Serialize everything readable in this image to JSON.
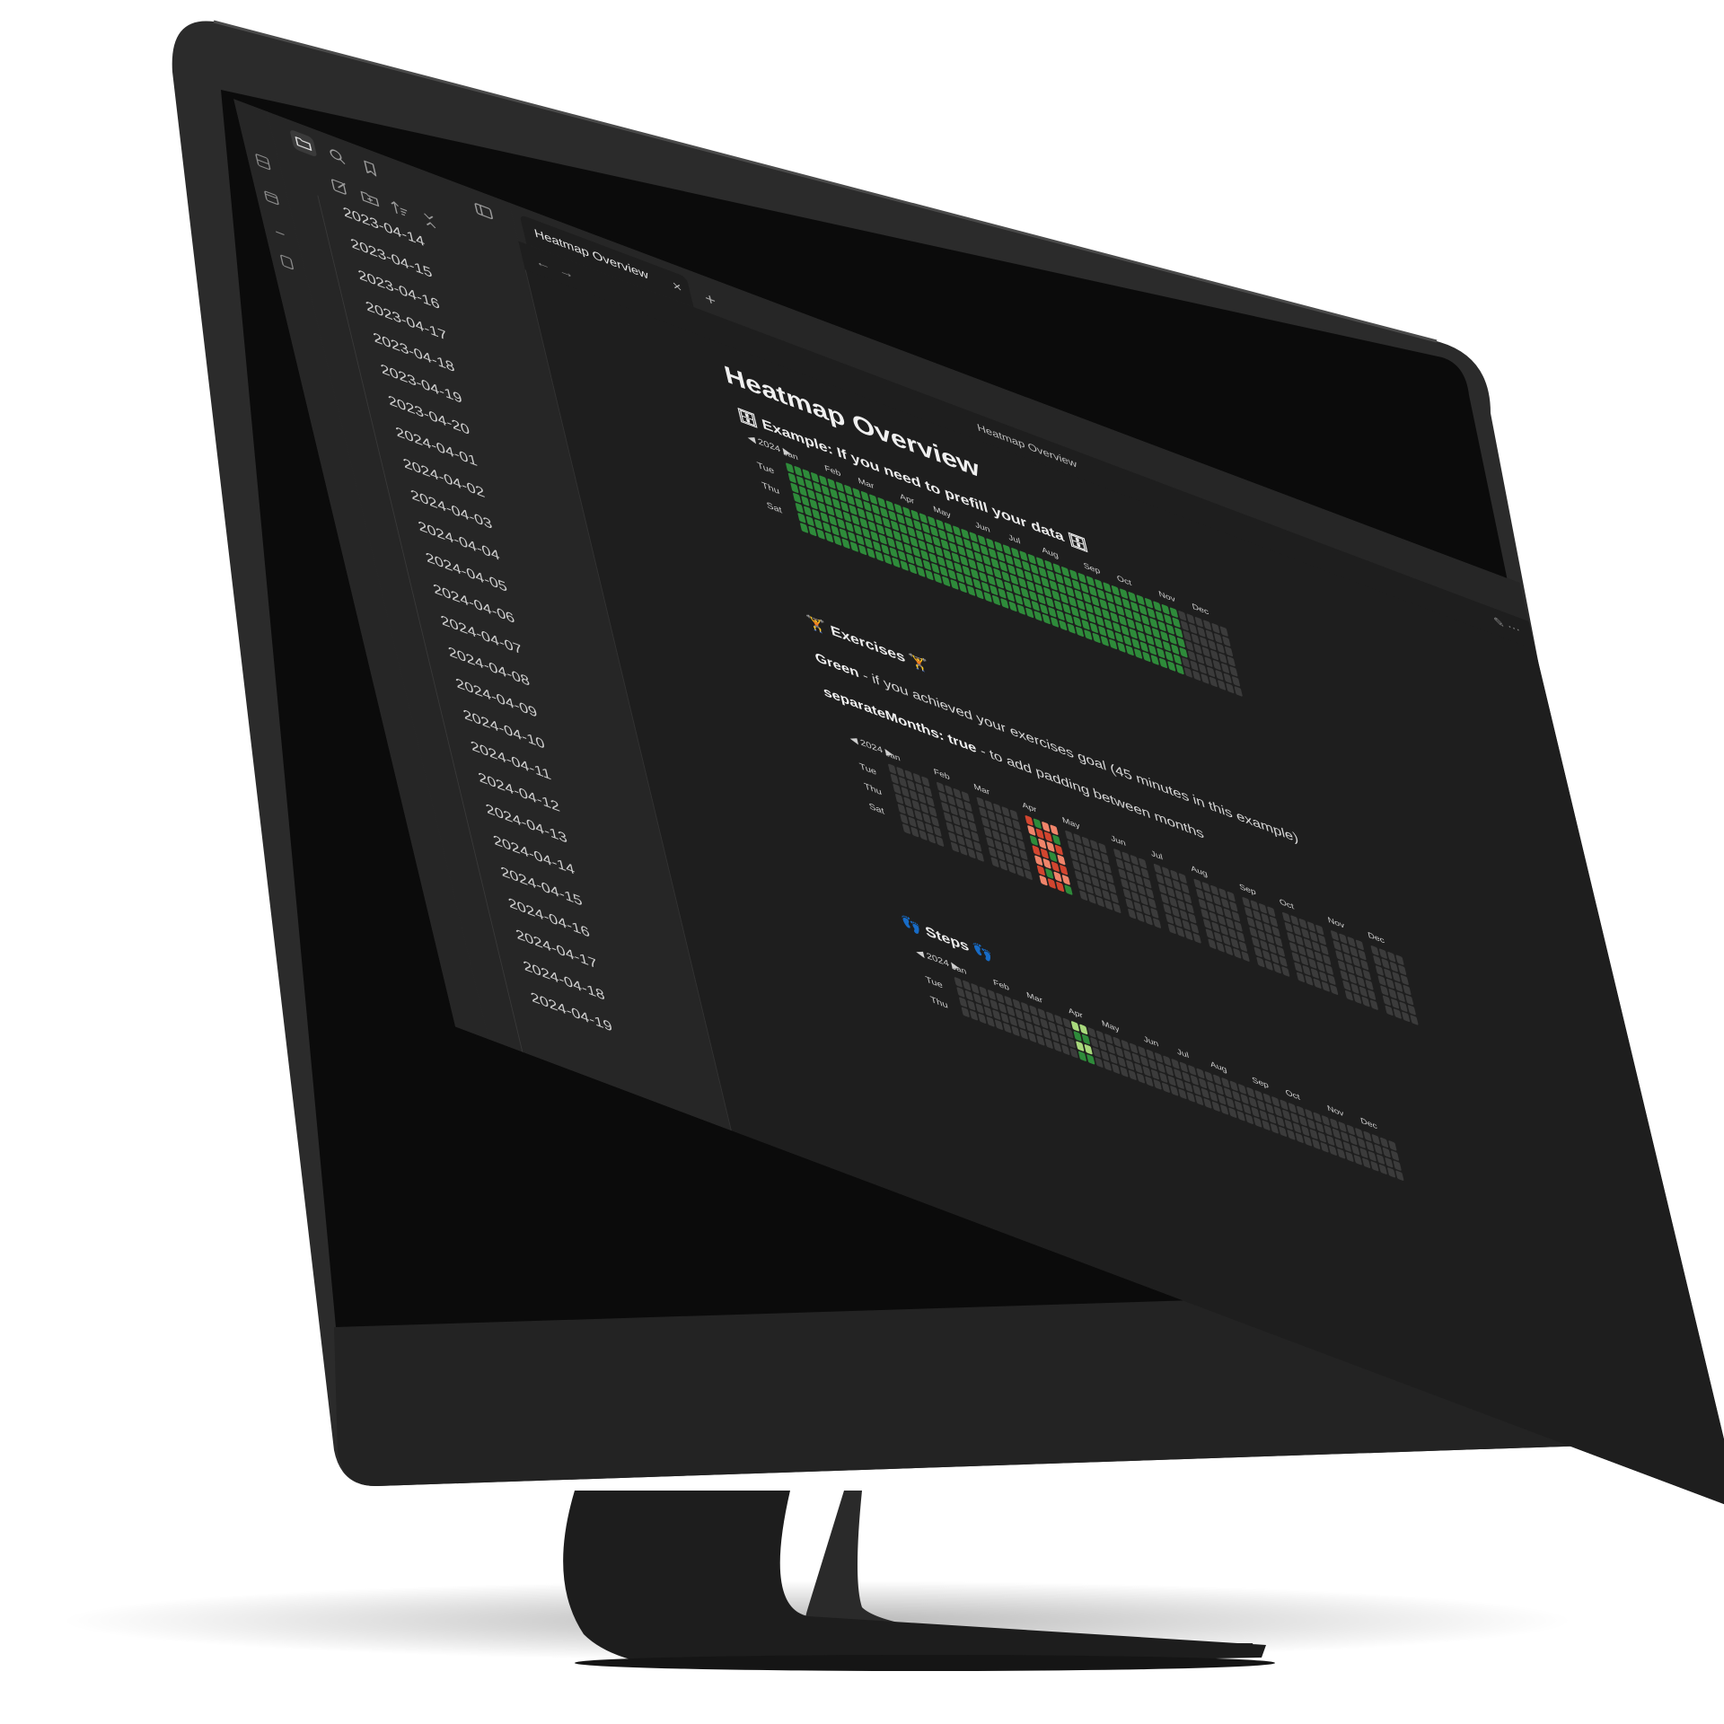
{
  "colors": {
    "app_bg": "#1e1e1e",
    "sidebar_bg": "#262626",
    "cell_empty": "#3b3b3b",
    "cell_green": "#2e8b3a",
    "cell_red": "#d2452f",
    "cell_salmon": "#f0846a",
    "cell_light_green": "#a8d97c"
  },
  "sidebar": {
    "top_icons": [
      "folder-icon",
      "search-icon",
      "bookmark-icon",
      "sidebar-toggle-icon"
    ],
    "nav_icons": [
      "new-note-icon",
      "new-folder-icon",
      "sort-icon",
      "collapse-all-icon"
    ],
    "files": [
      "2023-04-14",
      "2023-04-15",
      "2023-04-16",
      "2023-04-17",
      "2023-04-18",
      "2023-04-19",
      "2023-04-20",
      "2024-04-01",
      "2024-04-02",
      "2024-04-03",
      "2024-04-04",
      "2024-04-05",
      "2024-04-06",
      "2024-04-07",
      "2024-04-08",
      "2024-04-09",
      "2024-04-10",
      "2024-04-11",
      "2024-04-12",
      "2024-04-13",
      "2024-04-14",
      "2024-04-15",
      "2024-04-16",
      "2024-04-17",
      "2024-04-18",
      "2024-04-19"
    ]
  },
  "tabs": {
    "active_title": "Heatmap Overview",
    "close": "×",
    "new": "+"
  },
  "view": {
    "title": "Heatmap Overview",
    "back": "←",
    "forward": "→"
  },
  "content": {
    "title": "Heatmap Overview",
    "section1": "🗄 Example: If you need to prefill your data 🗄",
    "section2": "🏋 Exercises 🏋",
    "para1_bold": "Green",
    "para1_rest": " - if you achieved your exercises goal (45 minutes in this example)",
    "para2_bold": "separateMonths: true",
    "para2_rest": " - to add padding between months",
    "section3": "👣 Steps 👣"
  },
  "heatmaps": [
    {
      "year": "2024",
      "months": [
        "Jan",
        "Feb",
        "Mar",
        "Apr",
        "May",
        "Jun",
        "Jul",
        "Aug",
        "Sep",
        "Oct",
        "Nov",
        "Dec"
      ],
      "days": [
        "Tue",
        "Thu",
        "Sat"
      ],
      "separate_months": false,
      "filled_until_week": 46,
      "fill": "green"
    },
    {
      "year": "2024",
      "months": [
        "Jan",
        "Feb",
        "Mar",
        "Apr",
        "May",
        "Jun",
        "Jul",
        "Aug",
        "Sep",
        "Oct",
        "Nov",
        "Dec"
      ],
      "days": [
        "Tue",
        "Thu",
        "Sat"
      ],
      "separate_months": true,
      "active_month": "Apr",
      "fill": "red-green"
    },
    {
      "year": "2024",
      "months": [
        "Jan",
        "Feb",
        "Mar",
        "Apr",
        "May",
        "Jun",
        "Jul",
        "Aug",
        "Sep",
        "Oct",
        "Nov",
        "Dec"
      ],
      "days": [
        "Tue",
        "Thu"
      ],
      "separate_months": false,
      "active_month": "Apr",
      "fill": "light-green"
    }
  ]
}
